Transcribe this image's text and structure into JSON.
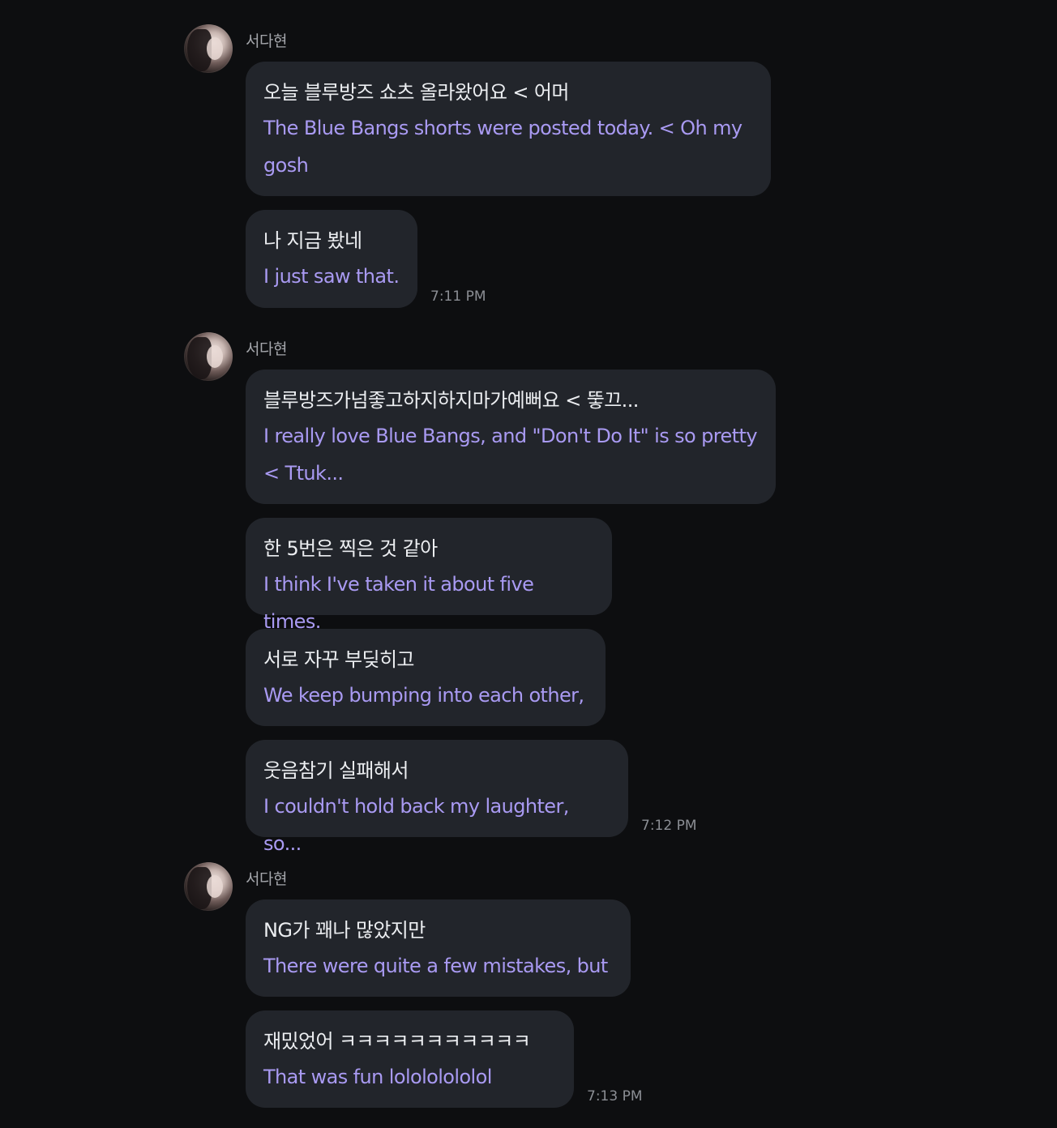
{
  "groups": [
    {
      "sender": "서다현",
      "messages": [
        {
          "ko": "오늘 블루방즈 쇼츠 올라왔어요 < 어머",
          "en": "The Blue Bangs shorts were posted today. < Oh my gosh",
          "time": ""
        },
        {
          "ko": "나 지금 봤네",
          "en": "I just saw that.",
          "time": "7:11 PM"
        }
      ]
    },
    {
      "sender": "서다현",
      "messages": [
        {
          "ko": "블루방즈가넘좋고하지하지마가예뻐요 < 뚷끄...",
          "en": "I really love Blue Bangs, and \"Don't Do It\" is so pretty < Ttuk...",
          "time": ""
        },
        {
          "ko": "한 5번은 찍은 것 같아",
          "en": "I think I've taken it about five times.",
          "time": ""
        },
        {
          "ko": "서로 자꾸 부딪히고",
          "en": "We keep bumping into each other,",
          "time": ""
        },
        {
          "ko": "웃음참기 실패해서",
          "en": "I couldn't hold back my laughter, so...",
          "time": "7:12 PM"
        }
      ]
    },
    {
      "sender": "서다현",
      "messages": [
        {
          "ko": "NG가 꽤나 많았지만",
          "en": "There were quite a few mistakes, but",
          "time": ""
        },
        {
          "ko": "재밌었어 ㅋㅋㅋㅋㅋㅋㅋㅋㅋㅋㅋ",
          "en": "That was fun lolololololol",
          "time": "7:13 PM"
        }
      ]
    }
  ]
}
